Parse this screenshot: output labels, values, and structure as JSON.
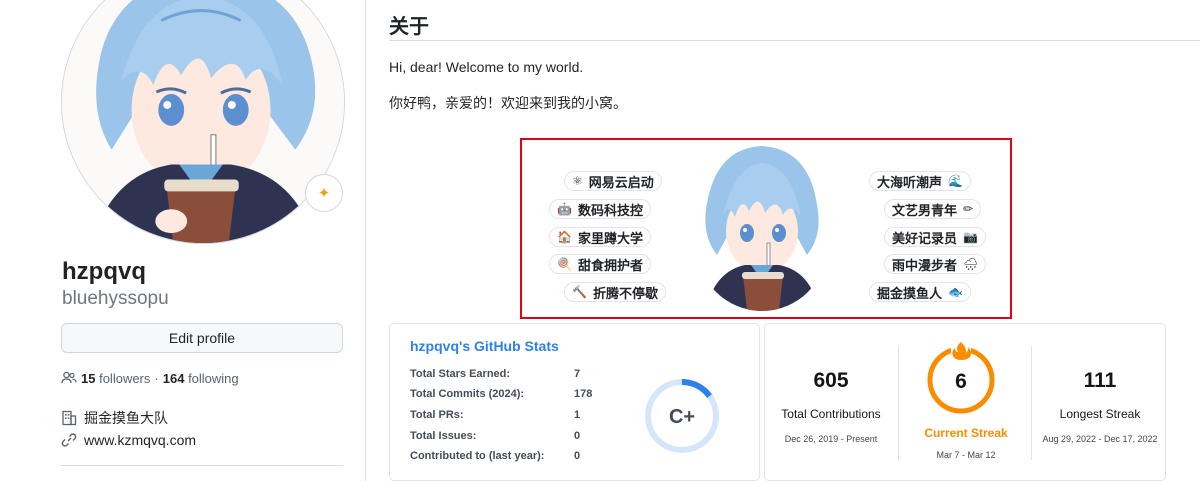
{
  "profile": {
    "name": "hzpqvq",
    "login": "bluehyssopu",
    "edit_button": "Edit profile",
    "followers_count": "15",
    "followers_label": "followers",
    "separator": "·",
    "following_count": "164",
    "following_label": "following",
    "organization": "掘金摸鱼大队",
    "website": "www.kzmqvq.com",
    "status_icon": "sparkle-icon"
  },
  "readme": {
    "title": "关于",
    "line_en": "Hi, dear! Welcome to my world.",
    "line_zh": "你好鸭，亲爱的！欢迎来到我的小窝。",
    "tags_left": [
      {
        "icon": "⚛",
        "text": "网易云启动"
      },
      {
        "icon": "🤖",
        "text": "数码科技控"
      },
      {
        "icon": "🏠",
        "text": "家里蹲大学"
      },
      {
        "icon": "🍭",
        "text": "甜食拥护者"
      },
      {
        "icon": "🔨",
        "text": "折腾不停歇"
      }
    ],
    "tags_right": [
      {
        "icon": "🌊",
        "text": "大海听潮声"
      },
      {
        "icon": "✏",
        "text": "文艺男青年"
      },
      {
        "icon": "📷",
        "text": "美好记录员"
      },
      {
        "icon": "🌧",
        "text": "雨中漫步者"
      },
      {
        "icon": "🐟",
        "text": "掘金摸鱼人"
      }
    ],
    "colors": {
      "banner_border": "#e0001a"
    }
  },
  "github_stats": {
    "title": "hzpqvq's GitHub Stats",
    "rows": [
      {
        "label": "Total Stars Earned:",
        "value": "7"
      },
      {
        "label": "Total Commits (2024):",
        "value": "178"
      },
      {
        "label": "Total PRs:",
        "value": "1"
      },
      {
        "label": "Total Issues:",
        "value": "0"
      },
      {
        "label": "Contributed to (last year):",
        "value": "0"
      }
    ],
    "rank": "C+",
    "rank_progress": 0.15,
    "colors": {
      "title": "#2f80ed",
      "ring": "#2f80ed"
    }
  },
  "streak": {
    "total": {
      "value": "605",
      "label": "Total Contributions",
      "range": "Dec 26, 2019 - Present"
    },
    "current": {
      "value": "6",
      "label": "Current Streak",
      "range": "Mar 7 - Mar 12"
    },
    "longest": {
      "value": "111",
      "label": "Longest Streak",
      "range": "Aug 29, 2022 - Dec 17, 2022"
    },
    "colors": {
      "ring": "#fb8c00",
      "accent": "#fb8c00"
    },
    "flame_icon": "fire-icon"
  }
}
